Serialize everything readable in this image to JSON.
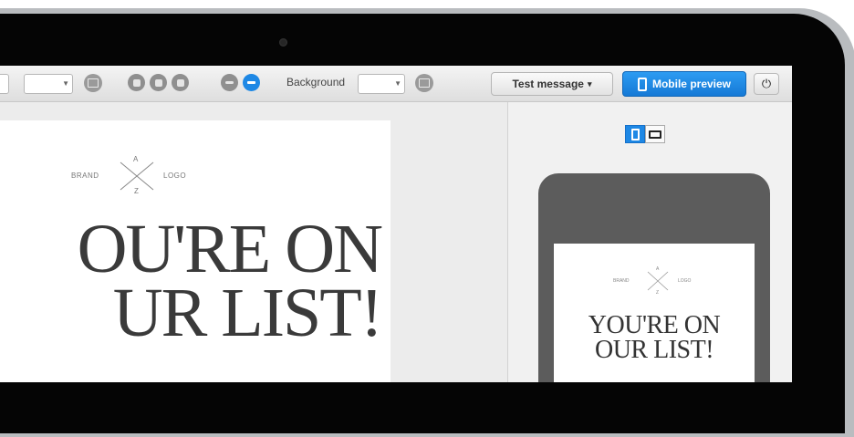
{
  "toolbar": {
    "background_label": "Background",
    "test_message_label": "Test message",
    "test_message_caret": "▾",
    "mobile_preview_label": "Mobile preview",
    "power_glyph": "⏻"
  },
  "editor": {
    "logo": {
      "left": "BRAND",
      "right": "LOGO",
      "top": "A",
      "bottom": "Z"
    },
    "headline_line1": "OU'RE ON",
    "headline_line2": "UR LIST!"
  },
  "preview": {
    "logo": {
      "left": "BRAND",
      "right": "LOGO",
      "top": "A",
      "bottom": "Z"
    },
    "headline_line1": "YOU'RE ON",
    "headline_line2": "OUR LIST!",
    "orientation_selected": "portrait"
  },
  "colors": {
    "accent": "#1e88e5",
    "bezel": "#050505",
    "frame": "#b9bcbf"
  },
  "icons": [
    "image-icon",
    "format-button-icon",
    "remove-icon",
    "add-icon",
    "mobile-phone-icon",
    "power-icon",
    "chevron-down-icon"
  ]
}
